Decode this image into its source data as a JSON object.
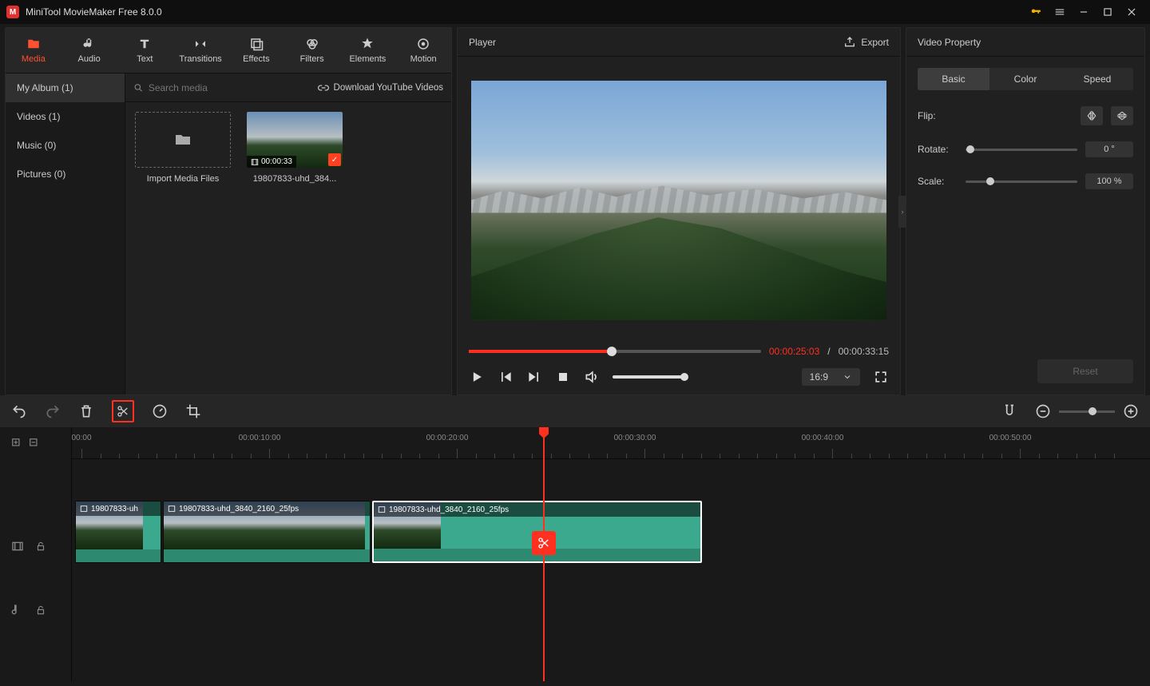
{
  "app": {
    "title": "MiniTool MovieMaker Free 8.0.0"
  },
  "ribbon": [
    {
      "label": "Media",
      "active": true
    },
    {
      "label": "Audio"
    },
    {
      "label": "Text"
    },
    {
      "label": "Transitions"
    },
    {
      "label": "Effects"
    },
    {
      "label": "Filters"
    },
    {
      "label": "Elements"
    },
    {
      "label": "Motion"
    }
  ],
  "sidebar": [
    {
      "label": "My Album (1)",
      "active": true
    },
    {
      "label": "Videos (1)"
    },
    {
      "label": "Music (0)"
    },
    {
      "label": "Pictures (0)"
    }
  ],
  "search": {
    "placeholder": "Search media"
  },
  "ytlink": "Download YouTube Videos",
  "media": {
    "import_label": "Import Media Files",
    "clip": {
      "name": "19807833-uhd_384...",
      "duration": "00:00:33"
    }
  },
  "player": {
    "title": "Player",
    "export": "Export",
    "cur": "00:00:25:03",
    "total": "00:00:33:15",
    "ratio": "16:9"
  },
  "props": {
    "title": "Video Property",
    "tabs": [
      "Basic",
      "Color",
      "Speed"
    ],
    "flip": "Flip:",
    "rotate": "Rotate:",
    "rotate_val": "0 °",
    "scale": "Scale:",
    "scale_val": "100 %",
    "reset": "Reset"
  },
  "timeline": {
    "marks": [
      "00:00",
      "00:00:10:00",
      "00:00:20:00",
      "00:00:30:00",
      "00:00:40:00",
      "00:00:50:00"
    ],
    "clips": [
      {
        "label": "19807833-uhd_3840_2160_25fps",
        "short": "19807833-uh"
      },
      {
        "label": "19807833-uhd_3840_2160_25fps"
      },
      {
        "label": "19807833-uhd_3840_2160_25fps"
      }
    ]
  }
}
